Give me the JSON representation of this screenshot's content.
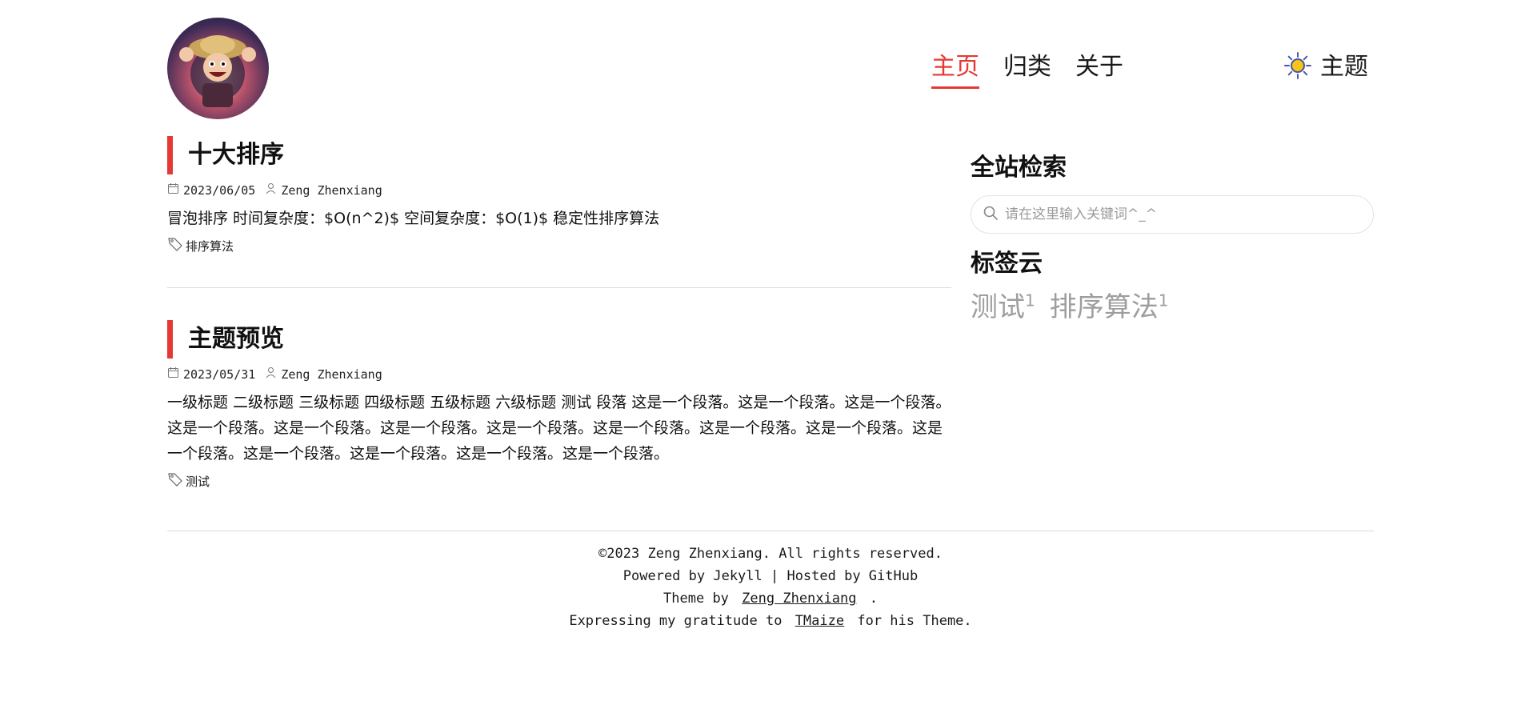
{
  "header": {
    "nav": [
      {
        "label": "主页",
        "active": true
      },
      {
        "label": "归类",
        "active": false
      },
      {
        "label": "关于",
        "active": false
      }
    ],
    "theme_label": "主题",
    "accent_color": "#e53935"
  },
  "posts": [
    {
      "title": "十大排序",
      "date": "2023/06/05",
      "author": "Zeng Zhenxiang",
      "excerpt": "冒泡排序 时间复杂度：$O(n^2)$ 空间复杂度：$O(1)$ 稳定性排序算法",
      "tag": "排序算法"
    },
    {
      "title": "主题预览",
      "date": "2023/05/31",
      "author": "Zeng Zhenxiang",
      "excerpt": "一级标题 二级标题 三级标题 四级标题 五级标题 六级标题 测试 段落 这是一个段落。这是一个段落。这是一个段落。这是一个段落。这是一个段落。这是一个段落。这是一个段落。这是一个段落。这是一个段落。这是一个段落。这是一个段落。这是一个段落。这是一个段落。这是一个段落。这是一个段落。",
      "tag": "测试"
    }
  ],
  "sidebar": {
    "search_title": "全站检索",
    "search_placeholder": "请在这里输入关键词^_^",
    "tagcloud_title": "标签云",
    "tags": [
      {
        "name": "测试",
        "count": "1"
      },
      {
        "name": "排序算法",
        "count": "1"
      }
    ]
  },
  "footer": {
    "copyright": "©2023 Zeng Zhenxiang. All rights reserved.",
    "powered": "Powered by Jekyll | Hosted by GitHub",
    "theme_prefix": "Theme by",
    "theme_author": "Zeng Zhenxiang",
    "theme_suffix": ".",
    "gratitude_prefix": "Expressing my gratitude to",
    "gratitude_link": "TMaize",
    "gratitude_suffix": "for his Theme."
  }
}
